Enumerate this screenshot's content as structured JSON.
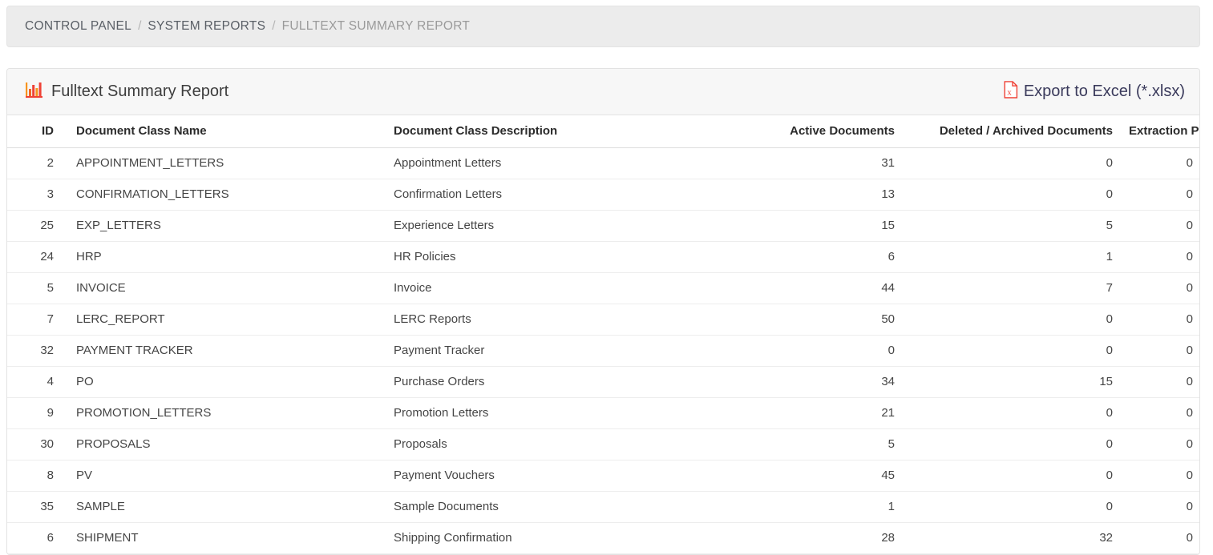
{
  "breadcrumb": {
    "separator": "/",
    "items": [
      {
        "label": "CONTROL PANEL",
        "state": "link"
      },
      {
        "label": "SYSTEM REPORTS",
        "state": "link"
      },
      {
        "label": "FULLTEXT SUMMARY REPORT",
        "state": "active"
      }
    ]
  },
  "panel": {
    "title": "Fulltext Summary Report",
    "title_icon": "bar-chart-icon",
    "export": {
      "label": "Export to Excel (*.xlsx)",
      "icon": "excel-file-icon"
    }
  },
  "colors": {
    "accent_red": "#ef4136",
    "accent_orange": "#f26522",
    "breadcrumb_bg": "#ececec",
    "panel_head_bg": "#f7f7f7",
    "border": "#e2e2e2",
    "text": "#454545",
    "muted_text": "#9a9a9a"
  },
  "table": {
    "columns": [
      {
        "key": "id",
        "label": "ID",
        "align": "right"
      },
      {
        "key": "name",
        "label": "Document Class Name",
        "align": "left"
      },
      {
        "key": "desc",
        "label": "Document Class Description",
        "align": "left"
      },
      {
        "key": "active",
        "label": "Active Documents",
        "align": "right"
      },
      {
        "key": "deleted",
        "label": "Deleted / Archived Documents",
        "align": "right"
      },
      {
        "key": "pending",
        "label": "Extraction Pending Documents",
        "align": "right"
      }
    ],
    "rows": [
      {
        "id": "2",
        "name": "APPOINTMENT_LETTERS",
        "desc": "Appointment Letters",
        "active": "31",
        "deleted": "0",
        "pending": "0"
      },
      {
        "id": "3",
        "name": "CONFIRMATION_LETTERS",
        "desc": "Confirmation Letters",
        "active": "13",
        "deleted": "0",
        "pending": "0"
      },
      {
        "id": "25",
        "name": "EXP_LETTERS",
        "desc": "Experience Letters",
        "active": "15",
        "deleted": "5",
        "pending": "0"
      },
      {
        "id": "24",
        "name": "HRP",
        "desc": "HR Policies",
        "active": "6",
        "deleted": "1",
        "pending": "0"
      },
      {
        "id": "5",
        "name": "INVOICE",
        "desc": "Invoice",
        "active": "44",
        "deleted": "7",
        "pending": "0"
      },
      {
        "id": "7",
        "name": "LERC_REPORT",
        "desc": "LERC Reports",
        "active": "50",
        "deleted": "0",
        "pending": "0"
      },
      {
        "id": "32",
        "name": "PAYMENT TRACKER",
        "desc": "Payment Tracker",
        "active": "0",
        "deleted": "0",
        "pending": "0"
      },
      {
        "id": "4",
        "name": "PO",
        "desc": "Purchase Orders",
        "active": "34",
        "deleted": "15",
        "pending": "0"
      },
      {
        "id": "9",
        "name": "PROMOTION_LETTERS",
        "desc": "Promotion Letters",
        "active": "21",
        "deleted": "0",
        "pending": "0"
      },
      {
        "id": "30",
        "name": "PROPOSALS",
        "desc": "Proposals",
        "active": "5",
        "deleted": "0",
        "pending": "0"
      },
      {
        "id": "8",
        "name": "PV",
        "desc": "Payment Vouchers",
        "active": "45",
        "deleted": "0",
        "pending": "0"
      },
      {
        "id": "35",
        "name": "SAMPLE",
        "desc": "Sample Documents",
        "active": "1",
        "deleted": "0",
        "pending": "0"
      },
      {
        "id": "6",
        "name": "SHIPMENT",
        "desc": "Shipping Confirmation",
        "active": "28",
        "deleted": "32",
        "pending": "0"
      }
    ]
  }
}
